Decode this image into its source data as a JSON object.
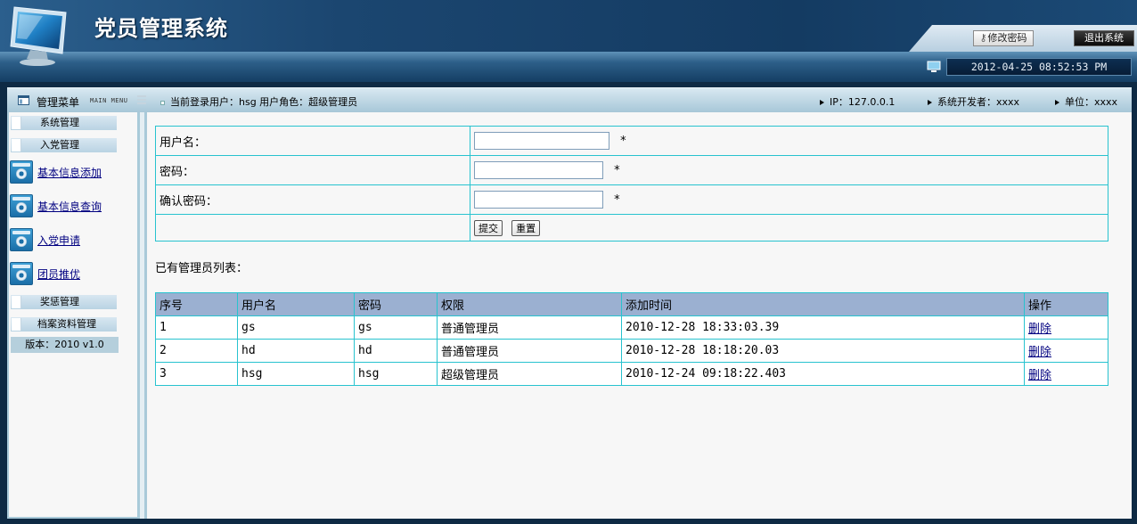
{
  "header": {
    "app_title": "党员管理系统",
    "change_password": "修改密码",
    "logout": "退出系统",
    "datetime": "2012-04-25 08:52:53 PM"
  },
  "infobar": {
    "menu_title": "管理菜单",
    "menu_title_en": "MAIN MENU",
    "current_user": "当前登录用户：hsg  用户角色：超级管理员",
    "ip": "IP：127.0.0.1",
    "developer": "系统开发者：xxxx",
    "unit": "单位：xxxx"
  },
  "sidebar": {
    "cat_system": "系统管理",
    "cat_party": "入党管理",
    "items": [
      {
        "label": "基本信息添加"
      },
      {
        "label": "基本信息查询"
      },
      {
        "label": "入党申请"
      },
      {
        "label": "团员推优"
      }
    ],
    "cat_reward": "奖惩管理",
    "cat_archive": "档案资料管理",
    "version": "版本：2010 v1.0"
  },
  "form": {
    "username_label": "用户名：",
    "password_label": "密码：",
    "confirm_label": "确认密码：",
    "required_mark": "*",
    "submit": "提交",
    "reset": "重置"
  },
  "list": {
    "title": "已有管理员列表：",
    "headers": [
      "序号",
      "用户名",
      "密码",
      "权限",
      "添加时间",
      "操作"
    ],
    "rows": [
      {
        "no": "1",
        "user": "gs",
        "pwd": "gs",
        "role": "普通管理员",
        "time": "2010-12-28 18:33:03.39",
        "action": "删除"
      },
      {
        "no": "2",
        "user": "hd",
        "pwd": "hd",
        "role": "普通管理员",
        "time": "2010-12-28 18:18:20.03",
        "action": "删除"
      },
      {
        "no": "3",
        "user": "hsg",
        "pwd": "hsg",
        "role": "超级管理员",
        "time": "2010-12-24 09:18:22.403",
        "action": "删除"
      }
    ]
  },
  "colors": {
    "header_dark": "#143a5e",
    "table_border": "#28c3cf",
    "table_header_bg": "#9bb0d1",
    "link": "#000080"
  }
}
